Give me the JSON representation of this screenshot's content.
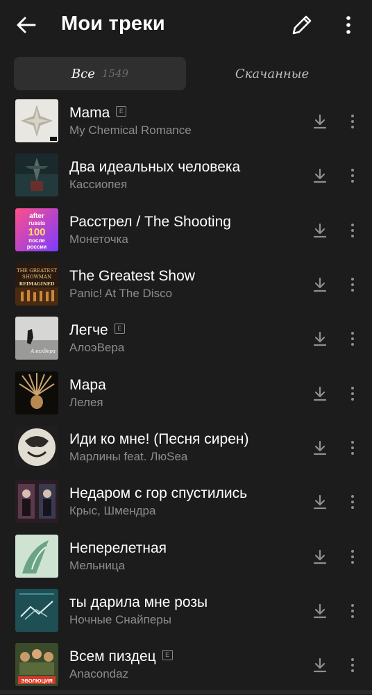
{
  "header": {
    "title": "Мои треки"
  },
  "tabs": {
    "all_label": "Все",
    "all_count": "1549",
    "downloaded_label": "Скачанные"
  },
  "explicit_badge": "E",
  "tracks": [
    {
      "title": "Mama",
      "artist": "My Chemical Romance",
      "explicit": true
    },
    {
      "title": "Два идеальных человека",
      "artist": "Кассиопея",
      "explicit": false
    },
    {
      "title": "Расстрел / The Shooting",
      "artist": "Монеточка",
      "explicit": false,
      "cover_text": [
        "after",
        "russia",
        "100",
        "после",
        "россии"
      ]
    },
    {
      "title": "The Greatest Show",
      "artist": "Panic! At The Disco",
      "explicit": false,
      "cover_text": [
        "THE GREATEST",
        "SHOWMAN",
        "REIMAGINED"
      ]
    },
    {
      "title": "Легче",
      "artist": "АлоэВера",
      "explicit": true,
      "cover_text": [
        "АлоэВера"
      ]
    },
    {
      "title": "Мара",
      "artist": "Лелея",
      "explicit": false
    },
    {
      "title": "Иди ко мне! (Песня сирен)",
      "artist": "Марлины feat. ЛюSea",
      "explicit": false
    },
    {
      "title": "Недаром с гор спустились",
      "artist": "Крыс, Шмендра",
      "explicit": false
    },
    {
      "title": "Неперелетная",
      "artist": "Мельница",
      "explicit": false
    },
    {
      "title": "ты дарила мне розы",
      "artist": "Ночные Снайперы",
      "explicit": false
    },
    {
      "title": "Всем пиздец",
      "artist": "Anacondaz",
      "explicit": true,
      "cover_text": [
        "ЭВОЛЮЦИЯ"
      ]
    }
  ]
}
